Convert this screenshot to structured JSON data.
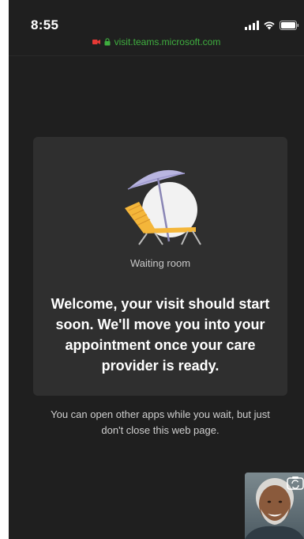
{
  "status_bar": {
    "time": "8:55"
  },
  "browser": {
    "url": "visit.teams.microsoft.com",
    "url_color": "#3fae3f",
    "recording_indicator_color": "#e53935"
  },
  "waiting_card": {
    "label": "Waiting room",
    "message": "Welcome, your visit should start soon. We'll move you into your appointment once your care provider is ready."
  },
  "hint": {
    "text": "You can open other apps while you wait, but just don't close this web page."
  },
  "icons": {
    "signal": "signal-bars-icon",
    "wifi": "wifi-icon",
    "battery": "battery-icon",
    "lock": "lock-icon",
    "camera_recording": "camera-recording-icon",
    "illustration": "beach-chair-umbrella-icon",
    "camera_switch": "camera-switch-icon"
  }
}
